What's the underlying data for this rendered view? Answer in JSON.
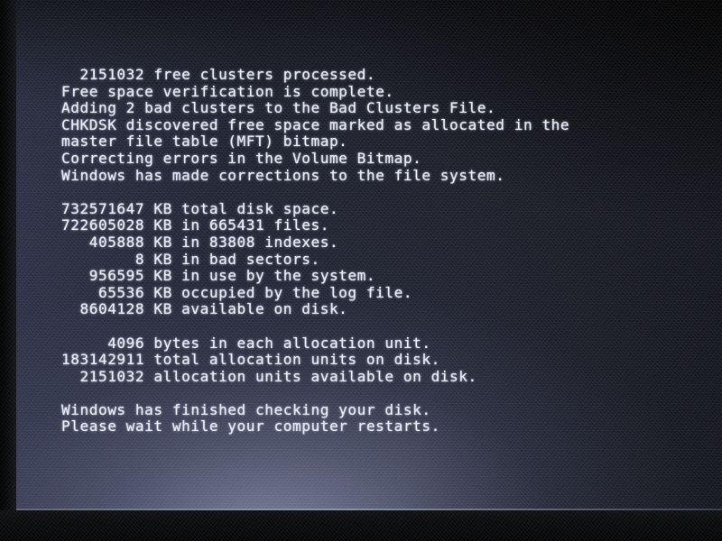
{
  "screen": {
    "kind": "chkdsk-console-output",
    "panel_background": "#20222e",
    "text_color": "#e9ebf2",
    "bezel_color": "#0a0b0d"
  },
  "console": {
    "lines": [
      "  2151032 free clusters processed.",
      "Free space verification is complete.",
      "Adding 2 bad clusters to the Bad Clusters File.",
      "CHKDSK discovered free space marked as allocated in the",
      "master file table (MFT) bitmap.",
      "Correcting errors in the Volume Bitmap.",
      "Windows has made corrections to the file system.",
      "",
      "732571647 KB total disk space.",
      "722605028 KB in 665431 files.",
      "   405888 KB in 83808 indexes.",
      "        8 KB in bad sectors.",
      "   956595 KB in use by the system.",
      "    65536 KB occupied by the log file.",
      "  8604128 KB available on disk.",
      "",
      "     4096 bytes in each allocation unit.",
      "183142911 total allocation units on disk.",
      "  2151032 allocation units available on disk.",
      "",
      "Windows has finished checking your disk.",
      "Please wait while your computer restarts."
    ]
  }
}
